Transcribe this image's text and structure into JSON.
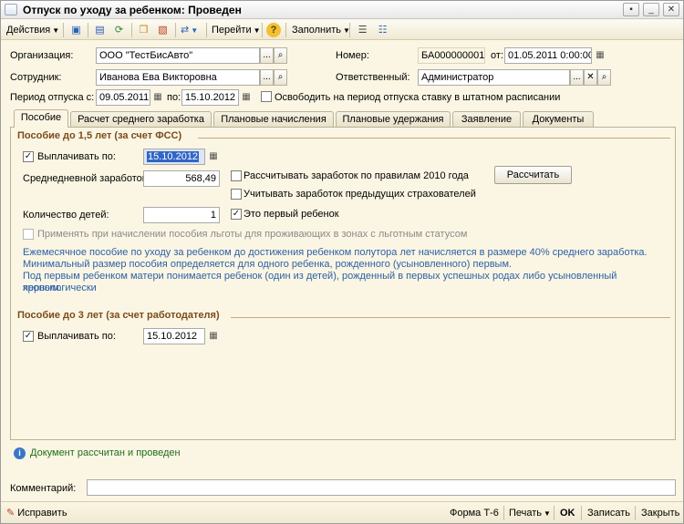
{
  "window": {
    "title": "Отпуск по уходу за ребенком: Проведен",
    "controls": {
      "menu": "▪",
      "minimize": "_",
      "maximize": "□",
      "close": "✕"
    }
  },
  "toolbar": {
    "actions": "Действия",
    "goto": "Перейти",
    "fill": "Заполнить",
    "help": "?"
  },
  "header": {
    "organization_label": "Организация:",
    "organization_value": "ООО \"ТестБисАвто\"",
    "employee_label": "Сотрудник:",
    "employee_value": "Иванова Ева Викторовна",
    "period_label": "Период отпуска с:",
    "period_from": "09.05.2011",
    "period_to_label": "по:",
    "period_to": "15.10.2012",
    "release_rate_label": "Освободить на период отпуска ставку в штатном расписании",
    "number_label": "Номер:",
    "number_value": "БА000000001",
    "date_label": "от:",
    "date_value": "01.05.2011  0:00:00",
    "responsible_label": "Ответственный:",
    "responsible_value": "Администратор",
    "select_btn": "...",
    "clear_btn": "✕"
  },
  "tabs": [
    {
      "label": "Пособие"
    },
    {
      "label": "Расчет среднего заработка"
    },
    {
      "label": "Плановые начисления"
    },
    {
      "label": "Плановые удержания"
    },
    {
      "label": "Заявление"
    },
    {
      "label": "Документы"
    }
  ],
  "benefit15": {
    "title": "Пособие до 1,5 лет (за счет ФСС)",
    "pay_until_label": "Выплачивать по:",
    "pay_until_value": "15.10.2012",
    "avg_earnings_label": "Среднедневной заработок:",
    "avg_earnings_value": "568,49",
    "rules2010_label": "Рассчитывать заработок по правилам 2010 года",
    "prev_insurers_label": "Учитывать заработок предыдущих страхователей",
    "calculate_button": "Рассчитать",
    "children_label": "Количество детей:",
    "children_value": "1",
    "first_child_label": "Это первый ребенок",
    "zones_label": "Применять при начислении пособия льготы для проживающих в зонах с льготным статусом",
    "info_lines": [
      "Ежемесячное пособие по уходу за ребенком до достижения ребенком полутора лет начисляется в размере 40% среднего заработка.",
      "Минимальный размер пособия определяется для одного ребенка, рожденного (усыновленного) первым.",
      "Под первым ребенком матери понимается ребенок (один из детей), рожденный в первых успешных родах либо усыновленный хронологически",
      "первым."
    ]
  },
  "benefit3": {
    "title": "Пособие до 3 лет (за счет работодателя)",
    "pay_until_label": "Выплачивать по:",
    "pay_until_value": "15.10.2012"
  },
  "status": {
    "message": "Документ рассчитан и проведен"
  },
  "comment": {
    "label": "Комментарий:",
    "value": ""
  },
  "bottom": {
    "fix": "Исправить",
    "form": "Форма Т-6",
    "print": "Печать",
    "ok": "OK",
    "save": "Записать",
    "close": "Закрыть"
  },
  "icons": {
    "search": "⌕",
    "calendar": "▦",
    "check": "✓",
    "info": "i"
  },
  "colors": {
    "background": "#fbf6e3",
    "section_title": "#7b4b1b",
    "info_text": "#2c5fa8",
    "status_text": "#1f6d1f"
  }
}
